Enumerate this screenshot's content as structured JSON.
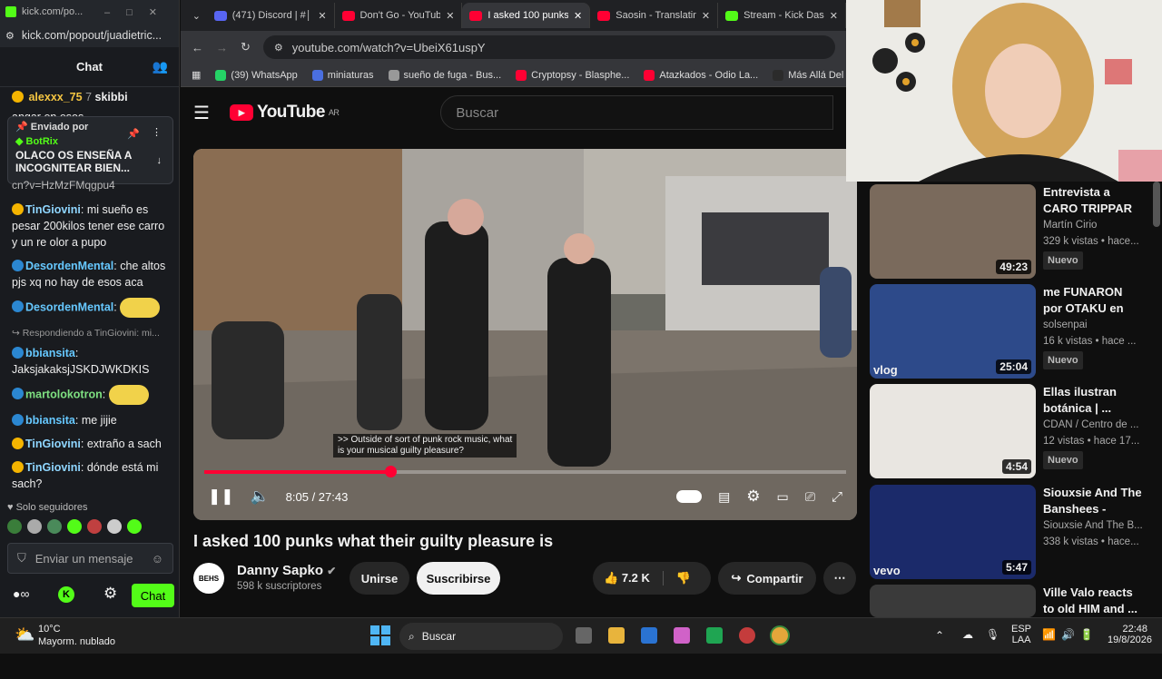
{
  "kick": {
    "window_url": "kick.com/po...",
    "popout_url": "kick.com/popout/juadietric...",
    "chat_title": "Chat",
    "pinned": {
      "label": "Enviado por",
      "user": "BotRix",
      "text1": "OLACO OS ENSEÑA A",
      "text2": "INCOGNITEAR BIEN..."
    },
    "top_partial": {
      "user1": "alexxx_75",
      "num": "7",
      "user2": "skibbi",
      "text": "angar en esos"
    },
    "partial_link": "cn?v=HzMzFMqgpu4",
    "messages": [
      {
        "user": "TinGiovini",
        "text": "mi sueño es pesar 200kilos tener ese carro y un re olor a pupo",
        "color": "#8fd6ff"
      },
      {
        "user": "DesordenMental",
        "text": "che altos pjs xq no hay de esos aca",
        "color": "#66c8ff"
      },
      {
        "user": "DesordenMental",
        "text": "",
        "color": "#66c8ff",
        "emote": true
      },
      {
        "reply": "Respondiendo a TinGiovini: mi..."
      },
      {
        "user": "bbiansita",
        "text": "JaksjakaksjJSKDJWKDKIS",
        "color": "#66c8ff"
      },
      {
        "user": "martolokotron",
        "text": "",
        "color": "#7ee081",
        "emote": true
      },
      {
        "user": "bbiansita",
        "text": "me jijie",
        "color": "#66c8ff"
      },
      {
        "user": "TinGiovini",
        "text": "extraño a sach",
        "color": "#8fd6ff"
      },
      {
        "user": "TinGiovini",
        "text": "dónde está mi sach?",
        "color": "#8fd6ff"
      }
    ],
    "followers_only": "Solo seguidores",
    "input_placeholder": "Enviar un mensaje",
    "chat_button": "Chat"
  },
  "browser": {
    "tabs": [
      {
        "label": "(471) Discord | #│ra",
        "color": "#5865f2"
      },
      {
        "label": "Don't Go - YouTube",
        "color": "#ff0033"
      },
      {
        "label": "I asked 100 punks",
        "color": "#ff0033",
        "active": true
      },
      {
        "label": "Saosin - Translating",
        "color": "#ff0033"
      },
      {
        "label": "Stream - Kick Dash",
        "color": "#53fc18"
      }
    ],
    "url": "youtube.com/watch?v=UbeiX61uspY",
    "bookmarks": [
      "(39) WhatsApp",
      "miniaturas",
      "sueño de fuga - Bus...",
      "Cryptopsy - Blasphe...",
      "Atazkados - Odio La...",
      "Más Allá Del Jardín..."
    ]
  },
  "youtube": {
    "logo": "YouTube",
    "region": "AR",
    "search_placeholder": "Buscar",
    "video": {
      "subtitle1": ">> Outside of sort of punk rock music, what",
      "subtitle2": "is your musical guilty pleasure?",
      "time": "8:05 / 27:43",
      "progress": 0.29
    },
    "title": "I asked 100 punks what their guilty pleasure is",
    "channel": "Danny Sapko",
    "subs": "598 k suscriptores",
    "avatar_text": "BEHS",
    "join": "Unirse",
    "subscribe": "Suscribirse",
    "likes": "7.2 K",
    "share": "Compartir",
    "recommendations": [
      {
        "title": "Entrevista a CARO TRIPPAR",
        "channel": "Martín Cirio",
        "meta": "329 k vistas • hace...",
        "badge": "Nuevo",
        "duration": "49:23"
      },
      {
        "title": "me FUNARON por OTAKU en el...",
        "channel": "solsenpai",
        "meta": "16 k vistas • hace ...",
        "badge": "Nuevo",
        "duration": "25:04",
        "thumb_text": "vlog"
      },
      {
        "title": "Ellas ilustran botánica | ...",
        "channel": "CDAN / Centro de ...",
        "meta": "12 vistas • hace 17...",
        "badge": "Nuevo",
        "duration": "4:54"
      },
      {
        "title": "Siouxsie And The Banshees - Fear...",
        "channel": "Siouxsie And The B...",
        "meta": "338 k vistas • hace...",
        "badge": "",
        "duration": "5:47",
        "thumb_text": "vevo"
      },
      {
        "title": "Ville Valo reacts to old HIM and ...",
        "channel": "",
        "meta": "",
        "badge": "",
        "duration": ""
      }
    ]
  },
  "taskbar": {
    "temp": "10°C",
    "weather": "Mayorm. nublado",
    "search": "Buscar",
    "lang1": "ESP",
    "lang2": "LAA",
    "time": "22:48",
    "date": "19/8/2026"
  }
}
